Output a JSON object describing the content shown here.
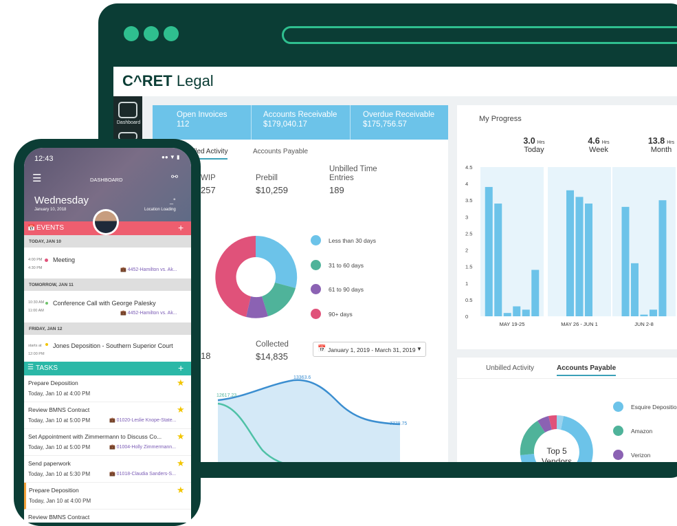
{
  "brand": {
    "logo_text": "C^RET Legal",
    "logo_bold": "C^RET",
    "logo_rest": " Legal"
  },
  "colors": {
    "frame": "#0b3d35",
    "accent": "#2fbf8f",
    "stats_bg": "#6cc3e9",
    "events_bar": "#ee5e6f",
    "tasks_bar": "#2bb8a7"
  },
  "sidebar": {
    "items": [
      {
        "label": "Dashboard",
        "icon": "dashboard-icon"
      },
      {
        "label": "",
        "icon": "mail-icon"
      }
    ]
  },
  "stats": [
    {
      "label": "Open Invoices",
      "value": "112"
    },
    {
      "label": "Accounts Receivable",
      "value": "$179,040.17"
    },
    {
      "label": "Overdue Receivable",
      "value": "$175,756.57"
    }
  ],
  "left_tabs": [
    {
      "label": "lled Activity",
      "active": true
    },
    {
      "label": "Accounts Payable",
      "active": false
    }
  ],
  "metrics": {
    "wip": {
      "label": "WIP",
      "value": "257"
    },
    "prebill": {
      "label": "Prebill",
      "value": "$10,259"
    },
    "unbilled": {
      "label1": "Unbilled Time",
      "label2": "Entries",
      "value": "189"
    },
    "partial": {
      "value": "18"
    },
    "collected": {
      "label": "Collected",
      "value": "$14,835"
    }
  },
  "aging_legend": [
    {
      "label": "Less than 30 days",
      "color": "#6cc3e9"
    },
    {
      "label": "31 to 60 days",
      "color": "#4fb39a"
    },
    {
      "label": "61 to 90 days",
      "color": "#8b62b3"
    },
    {
      "label": "90+ days",
      "color": "#e0527a"
    }
  ],
  "date_range": "January 1, 2019 - March 31, 2019",
  "trend_labels": [
    "12617.23",
    "13363.6",
    "7779.75"
  ],
  "progress": {
    "title": "My Progress",
    "stats": [
      {
        "value": "3.0",
        "unit": "Hrs",
        "label": "Today"
      },
      {
        "value": "4.6",
        "unit": "Hrs",
        "label": "Week"
      },
      {
        "value": "13.8",
        "unit": "Hrs",
        "label": "Month"
      }
    ]
  },
  "chart_data": {
    "type": "bar",
    "yticks": [
      "4.5",
      "4",
      "3.5",
      "3",
      "2.5",
      "2",
      "1.5",
      "1",
      "0.5",
      "0"
    ],
    "ylim": [
      0,
      4.5
    ],
    "groups": [
      {
        "label": "MAY 19-25",
        "values": [
          3.9,
          3.4,
          0.1,
          0.3,
          0.2,
          1.4
        ]
      },
      {
        "label": "MAY 26 - JUN 1",
        "values": [
          3.8,
          3.6,
          3.4
        ]
      },
      {
        "label": "JUN 2-8",
        "values": [
          3.3,
          1.6,
          0.05,
          0.2,
          3.5
        ]
      }
    ]
  },
  "ap_tabs": [
    {
      "label": "Unbilled Activity",
      "active": false
    },
    {
      "label": "Accounts Payable",
      "active": true
    }
  ],
  "vendors": {
    "center_line1": "Top 5",
    "center_line2": "Vendors",
    "legend": [
      {
        "label": "Esquire Depositio",
        "color": "#6cc3e9"
      },
      {
        "label": "Amazon",
        "color": "#4fb39a"
      },
      {
        "label": "Verizon",
        "color": "#8b62b3"
      }
    ]
  },
  "phone": {
    "time": "12:43",
    "header_title": "DASHBOARD",
    "day": "Wednesday",
    "date": "January 10, 2018",
    "temp": "_°",
    "location": "Location Loading",
    "events_label": "EVENTS",
    "tasks_label": "TASKS",
    "events": [
      {
        "day": "TODAY, JAN 10",
        "start": "4:00 PM",
        "end": "4:30 PM",
        "title": "Meeting",
        "case": "4452-Hamilton vs. Ak...",
        "dot": "#e0527a"
      },
      {
        "day": "TOMORROW, JAN 11",
        "start": "10:30 AM",
        "end": "11:00 AM",
        "title": "Conference Call with George Palesky",
        "case": "4452-Hamilton vs. Ak...",
        "dot": "#6fc36b"
      },
      {
        "day": "FRIDAY, JAN 12",
        "start": "starts at",
        "end": "12:00 PM",
        "title": "Jones Deposition - Southern Superior Court",
        "case": "",
        "dot": "#f2c500"
      }
    ],
    "tasks": [
      {
        "title": "Prepare Deposition",
        "due": "Today, Jan 10 at 4:00 PM",
        "case": ""
      },
      {
        "title": "Review BMNS Contract",
        "due": "Today, Jan 10 at 5:00 PM",
        "case": "01020-Leslie Knope-State..."
      },
      {
        "title": "Set Appointment with Zimmermann to Discuss Co...",
        "due": "Today, Jan 10 at 5:00 PM",
        "case": "01004-Holly Zimmermann..."
      },
      {
        "title": "Send paperwork",
        "due": "Today, Jan 10 at 5:30 PM",
        "case": "01018-Claudia Sanders-S..."
      },
      {
        "title": "Prepare Deposition",
        "due": "Today, Jan 10 at 4:00 PM",
        "case": ""
      },
      {
        "title": "Review BMNS Contract",
        "due": "",
        "case": ""
      }
    ]
  }
}
